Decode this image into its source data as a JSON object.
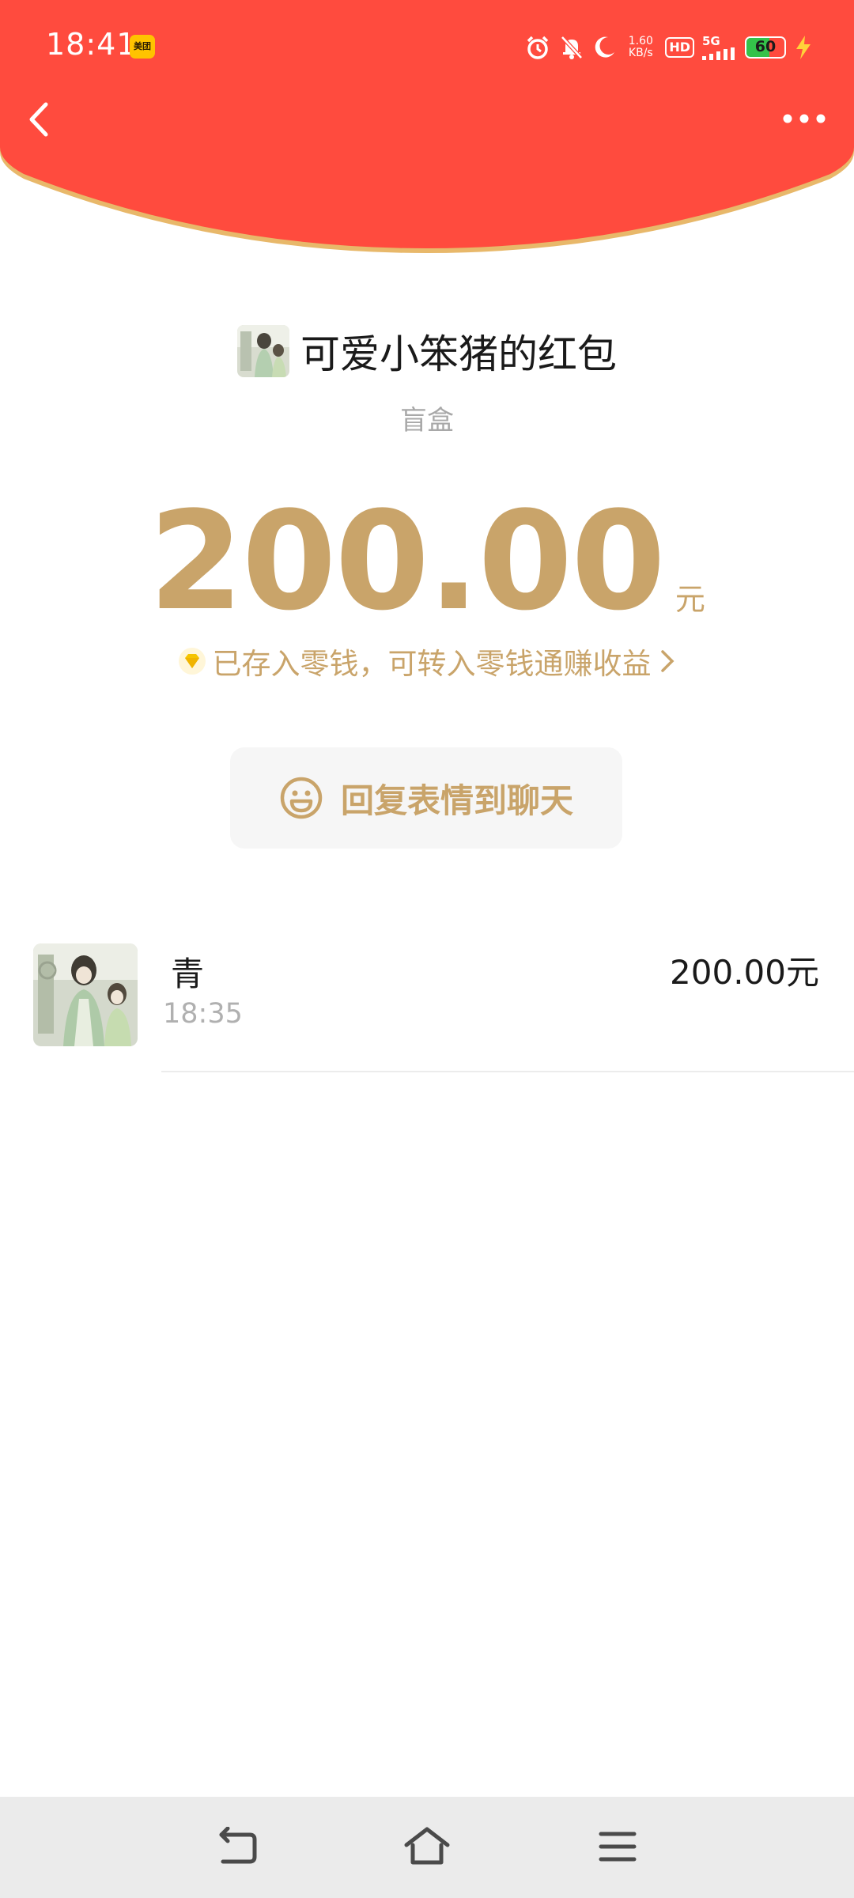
{
  "status_bar": {
    "time": "18:41",
    "app_badge": "美团",
    "net_speed_value": "1.60",
    "net_speed_unit": "KB/s",
    "hd_label": "HD",
    "network_label": "5G",
    "battery_level": "60",
    "battery_fraction": 0.6,
    "icons": [
      "alarm-icon",
      "mute-icon",
      "moon-icon",
      "signal-icon",
      "charging-icon"
    ]
  },
  "header": {
    "color": "#ff4b3e",
    "back_icon": "chevron-left-icon",
    "more_icon": "more-dots-icon"
  },
  "packet": {
    "sender_title": "可爱小笨猪的红包",
    "type_label": "盲盒",
    "amount": "200.00",
    "unit": "元",
    "notice": "已存入零钱，可转入零钱通赚收益",
    "accent_color": "#c9a46a"
  },
  "reply_button": {
    "label": "回复表情到聊天",
    "icon": "smiley-icon"
  },
  "receivers": [
    {
      "name": "青",
      "time": "18:35",
      "amount": "200.00元"
    }
  ],
  "nav_bar": {
    "icons": [
      "back-nav-icon",
      "home-nav-icon",
      "menu-nav-icon"
    ]
  }
}
